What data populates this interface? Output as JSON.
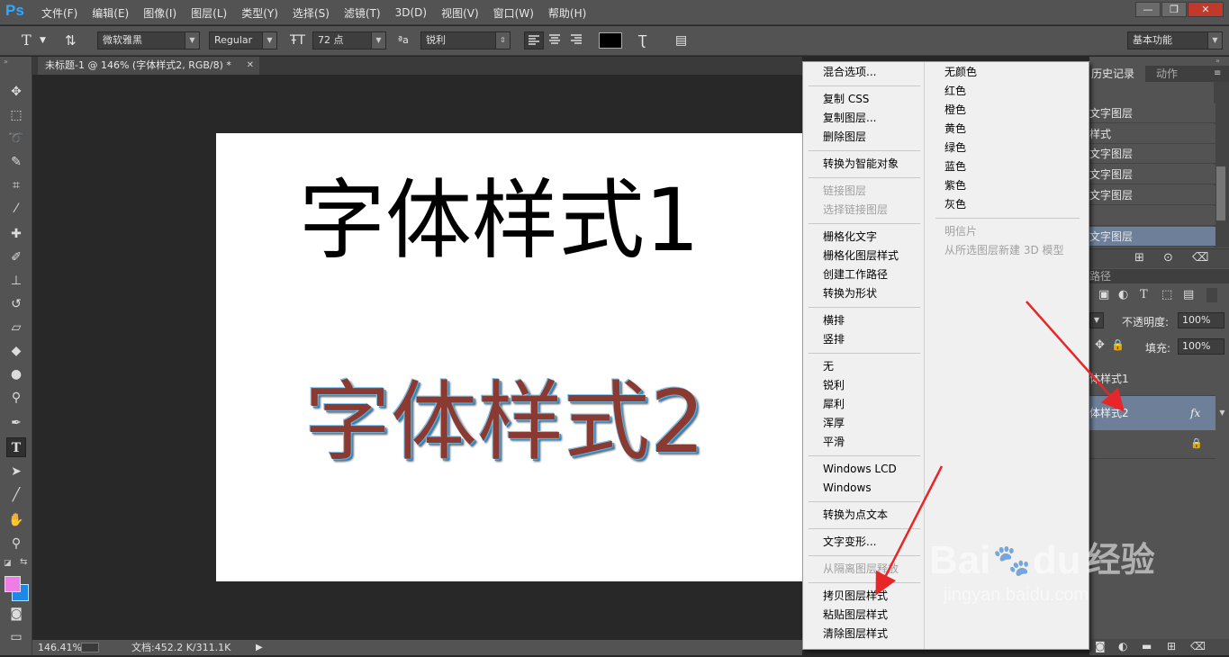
{
  "app": {
    "logo": "Ps"
  },
  "menubar": {
    "items": [
      "文件(F)",
      "编辑(E)",
      "图像(I)",
      "图层(L)",
      "类型(Y)",
      "选择(S)",
      "滤镜(T)",
      "3D(D)",
      "视图(V)",
      "窗口(W)",
      "帮助(H)"
    ]
  },
  "window_controls": {
    "minimize": "—",
    "restore": "❐",
    "close": "✕"
  },
  "options": {
    "font_family": "微软雅黑",
    "font_style": "Regular",
    "font_size": "72 点",
    "aa_label": "ªa",
    "antialias": "锐利",
    "workspace": "基本功能"
  },
  "document": {
    "tab_title": "未标题-1 @ 146% (字体样式2, RGB/8) *",
    "text_layer_1": "字体样式1",
    "text_layer_2": "字体样式2"
  },
  "status": {
    "zoom": "146.41%",
    "doc_size": "文档:452.2 K/311.1K"
  },
  "panels": {
    "history_tab": "历史记录",
    "actions_tab": "动作",
    "history_items": [
      "文字图层",
      "样式",
      "文字图层",
      "文字图层",
      "文字图层",
      "",
      "文字图层"
    ],
    "paths_tab": "路径",
    "opacity_label": "不透明度:",
    "opacity_value": "100%",
    "fill_label": "填充:",
    "fill_value": "100%",
    "layers": [
      "体样式1",
      "体样式2"
    ],
    "fx_label": "fx"
  },
  "context_menu": {
    "left": [
      {
        "label": "混合选项...",
        "disabled": false
      },
      {
        "label": "复制 CSS",
        "disabled": false
      },
      {
        "label": "复制图层...",
        "disabled": false
      },
      {
        "label": "删除图层",
        "disabled": false
      },
      {
        "label": "转换为智能对象",
        "disabled": false
      },
      {
        "label": "链接图层",
        "disabled": true
      },
      {
        "label": "选择链接图层",
        "disabled": true
      },
      {
        "label": "栅格化文字",
        "disabled": false
      },
      {
        "label": "栅格化图层样式",
        "disabled": false
      },
      {
        "label": "创建工作路径",
        "disabled": false
      },
      {
        "label": "转换为形状",
        "disabled": false
      },
      {
        "label": "横排",
        "disabled": false
      },
      {
        "label": "竖排",
        "disabled": false
      },
      {
        "label": "无",
        "disabled": false
      },
      {
        "label": "锐利",
        "disabled": false
      },
      {
        "label": "犀利",
        "disabled": false
      },
      {
        "label": "浑厚",
        "disabled": false
      },
      {
        "label": "平滑",
        "disabled": false
      },
      {
        "label": "Windows LCD",
        "disabled": false
      },
      {
        "label": "Windows",
        "disabled": false
      },
      {
        "label": "转换为点文本",
        "disabled": false
      },
      {
        "label": "文字变形...",
        "disabled": false
      },
      {
        "label": "从隔离图层释放",
        "disabled": true
      },
      {
        "label": "拷贝图层样式",
        "disabled": false
      },
      {
        "label": "粘贴图层样式",
        "disabled": false
      },
      {
        "label": "清除图层样式",
        "disabled": false
      }
    ],
    "right": [
      {
        "label": "无颜色",
        "disabled": false
      },
      {
        "label": "红色",
        "disabled": false
      },
      {
        "label": "橙色",
        "disabled": false
      },
      {
        "label": "黄色",
        "disabled": false
      },
      {
        "label": "绿色",
        "disabled": false
      },
      {
        "label": "蓝色",
        "disabled": false
      },
      {
        "label": "紫色",
        "disabled": false
      },
      {
        "label": "灰色",
        "disabled": false
      },
      {
        "label": "明信片",
        "disabled": true
      },
      {
        "label": "从所选图层新建 3D 模型",
        "disabled": true
      }
    ]
  },
  "watermark": {
    "brand": "Bai",
    "brand2": "du",
    "product": "经验",
    "url": "jingyan.baidu.com"
  },
  "colors": {
    "accent": "#31a8ff",
    "arrow": "#e8262a",
    "foreground_swatch": "#ee7ee6",
    "background_swatch": "#1e88e5"
  }
}
